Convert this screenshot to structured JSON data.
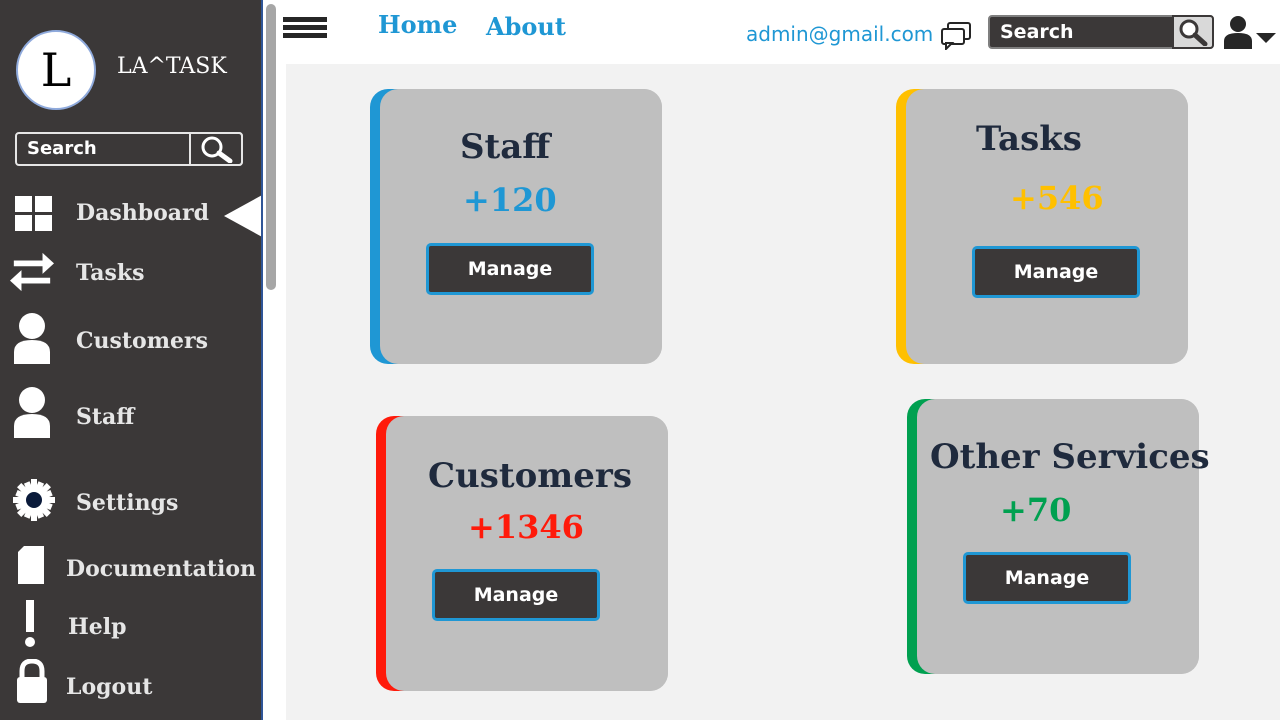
{
  "app": {
    "logo_letter": "L",
    "brand": "LA^TASK"
  },
  "sidebar": {
    "search_label": "Search",
    "items": [
      {
        "label": "Dashboard",
        "icon": "grid-icon",
        "active": true
      },
      {
        "label": "Tasks",
        "icon": "swap-arrows-icon"
      },
      {
        "label": "Customers",
        "icon": "person-icon"
      },
      {
        "label": "Staff",
        "icon": "person-icon"
      },
      {
        "label": "Settings",
        "icon": "gear-icon"
      },
      {
        "label": "Documentation",
        "icon": "document-icon"
      },
      {
        "label": "Help",
        "icon": "exclamation-icon"
      },
      {
        "label": "Logout",
        "icon": "lock-icon"
      }
    ]
  },
  "topbar": {
    "links": [
      "Home",
      "About"
    ],
    "email": "admin@gmail.com",
    "search_label": "Search"
  },
  "cards": [
    {
      "title": "Staff",
      "count": "+120",
      "button": "Manage",
      "accent": "#1f97d4"
    },
    {
      "title": "Tasks",
      "count": "+546",
      "button": "Manage",
      "accent": "#ffc000"
    },
    {
      "title": "Customers",
      "count": "+1346",
      "button": "Manage",
      "accent": "#ff1a0a"
    },
    {
      "title": "Other Services",
      "count": "+70",
      "button": "Manage",
      "accent": "#00a050"
    }
  ],
  "colors": {
    "sidebar": "#3b3838",
    "link": "#1f97d4",
    "card": "#bfbfbf",
    "main_bg": "#f2f2f2"
  }
}
